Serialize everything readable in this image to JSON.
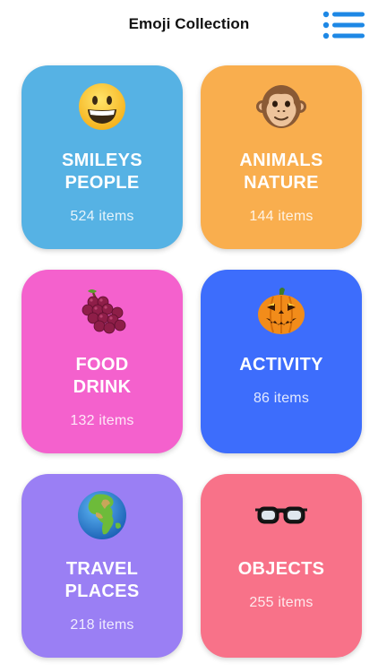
{
  "header": {
    "title": "Emoji Collection",
    "menu_icon": "list-icon",
    "accent": "#1e88e5"
  },
  "categories": [
    {
      "line1": "SMILEYS",
      "line2": "PEOPLE",
      "count": "524 items",
      "icon": "grinning-face-icon",
      "color": "#56b2e4"
    },
    {
      "line1": "ANIMALS",
      "line2": "NATURE",
      "count": "144 items",
      "icon": "monkey-face-icon",
      "color": "#f9ae4e"
    },
    {
      "line1": "FOOD",
      "line2": "DRINK",
      "count": "132 items",
      "icon": "grapes-icon",
      "color": "#f461cd"
    },
    {
      "line1": "ACTIVITY",
      "line2": "",
      "count": "86 items",
      "icon": "jack-o-lantern-icon",
      "color": "#3d6dfc"
    },
    {
      "line1": "TRAVEL",
      "line2": "PLACES",
      "count": "218 items",
      "icon": "globe-icon",
      "color": "#9a7ff4"
    },
    {
      "line1": "OBJECTS",
      "line2": "",
      "count": "255 items",
      "icon": "glasses-icon",
      "color": "#f87289"
    }
  ]
}
